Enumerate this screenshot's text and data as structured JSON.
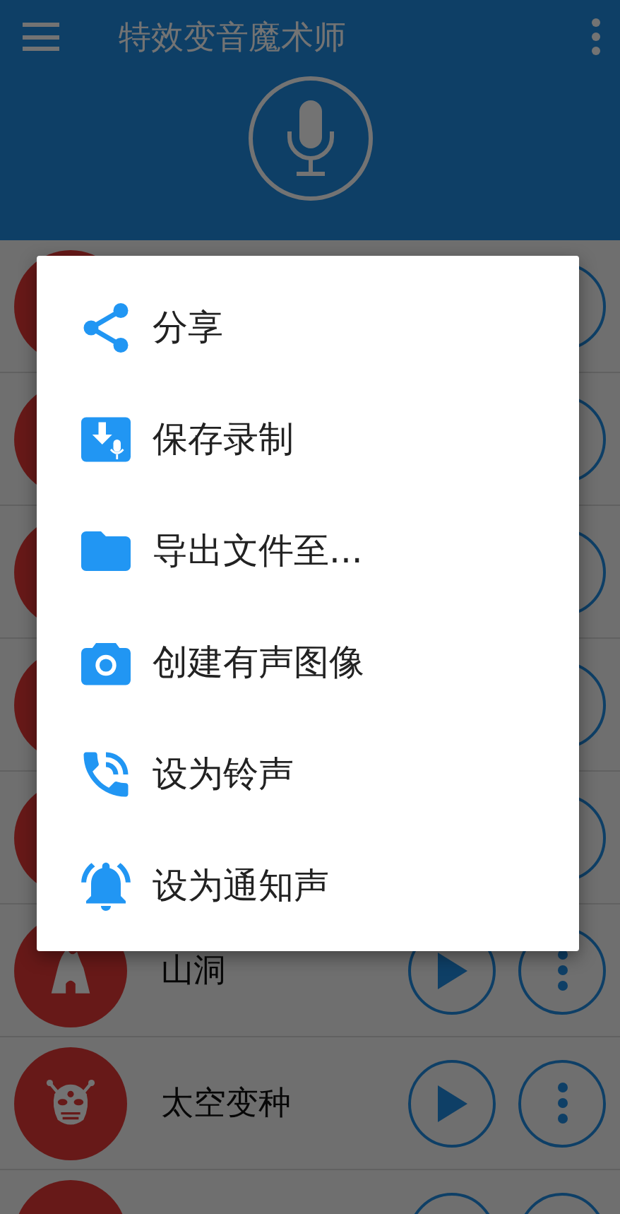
{
  "app_bar": {
    "title": "特效变音魔术师"
  },
  "sounds": [
    {
      "kind": "covered"
    },
    {
      "kind": "covered"
    },
    {
      "kind": "covered"
    },
    {
      "kind": "covered"
    },
    {
      "kind": "covered"
    },
    {
      "kind": "cave",
      "name": "山洞"
    },
    {
      "kind": "alien",
      "name": "太空变种"
    },
    {
      "kind": "cut"
    }
  ],
  "context_menu": {
    "items": [
      {
        "label": "分享"
      },
      {
        "label": "保存录制"
      },
      {
        "label": "导出文件至..."
      },
      {
        "label": "创建有声图像"
      },
      {
        "label": "设为铃声"
      },
      {
        "label": "设为通知声"
      }
    ]
  }
}
